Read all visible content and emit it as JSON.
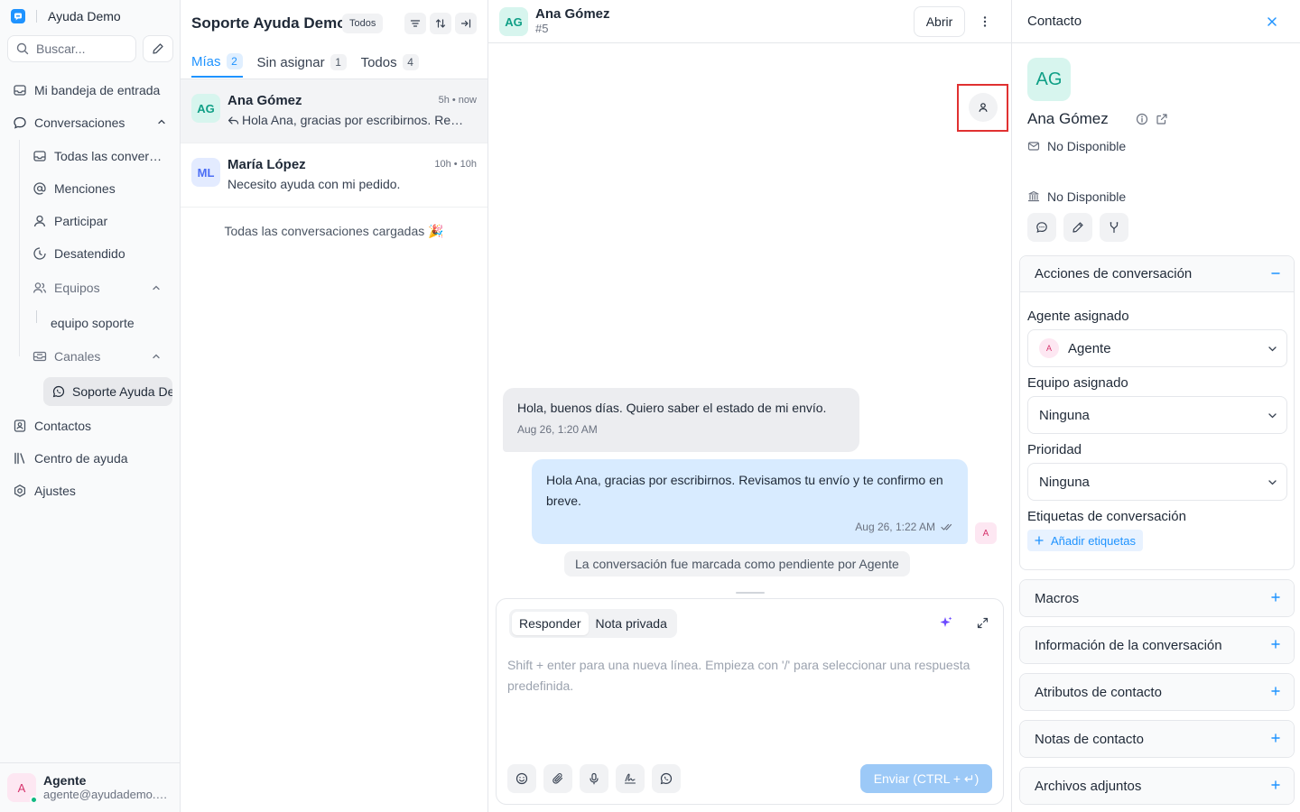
{
  "app": {
    "name": "Ayuda Demo"
  },
  "sidebar": {
    "search_placeholder": "Buscar...",
    "nav": {
      "inbox": "Mi bandeja de entrada",
      "conversations": "Conversaciones",
      "all": "Todas las conversaciones",
      "mentions": "Menciones",
      "participating": "Participar",
      "unattended": "Desatendido",
      "teams": "Equipos",
      "team_support": "equipo soporte",
      "channels": "Canales",
      "channel_support": "Soporte Ayuda Demo",
      "contacts": "Contactos",
      "help_center": "Centro de ayuda",
      "settings": "Ajustes"
    },
    "user": {
      "initial": "A",
      "name": "Agente",
      "email": "agente@ayudademo.com"
    }
  },
  "conv_list": {
    "title": "Soporte Ayuda Demo",
    "badge": "Todos",
    "tabs": [
      {
        "label": "Mías",
        "count": "2"
      },
      {
        "label": "Sin asignar",
        "count": "1"
      },
      {
        "label": "Todos",
        "count": "4"
      }
    ],
    "items": [
      {
        "initials": "AG",
        "name": "Ana Gómez",
        "time": "5h • now",
        "preview": "Hola Ana, gracias por escribirnos. Revisamos tu envío y te confirmo en breve."
      },
      {
        "initials": "ML",
        "name": "María López",
        "time": "10h • 10h",
        "preview": "Necesito ayuda con mi pedido."
      }
    ],
    "all_loaded": "Todas las conversaciones cargadas 🎉"
  },
  "chat": {
    "contact_initials": "AG",
    "contact_name": "Ana Gómez",
    "conv_number": "#5",
    "open_button": "Abrir",
    "messages": [
      {
        "text": "Hola, buenos días. Quiero saber el estado de mi envío.",
        "time": "Aug 26, 1:20 AM"
      },
      {
        "text": "Hola Ana, gracias por escribirnos. Revisamos tu envío y te confirmo en breve.",
        "time": "Aug 26, 1:22 AM",
        "avatar": "A"
      }
    ],
    "activity": "La conversación fue marcada como pendiente por Agente",
    "composer": {
      "reply_tab": "Responder",
      "private_tab": "Nota privada",
      "placeholder": "Shift + enter para una nueva línea. Empieza con '/' para seleccionar una respuesta predefinida.",
      "send_label": "Enviar (CTRL + ↵)"
    }
  },
  "contact": {
    "header": "Contacto",
    "initials": "AG",
    "name": "Ana Gómez",
    "email": "No Disponible",
    "company": "No Disponible",
    "actions_section": {
      "title": "Acciones de conversación",
      "assigned_agent_label": "Agente asignado",
      "assigned_agent_initial": "A",
      "assigned_agent": "Agente",
      "assigned_team_label": "Equipo asignado",
      "assigned_team": "Ninguna",
      "priority_label": "Prioridad",
      "priority": "Ninguna",
      "labels_label": "Etiquetas de conversación",
      "add_labels": "Añadir etiquetas"
    },
    "sections": [
      "Macros",
      "Información de la conversación",
      "Atributos de contacto",
      "Notas de contacto",
      "Archivos adjuntos"
    ]
  },
  "colors": {
    "accent": "#1f93ff",
    "avatar_green": "#0f9f86",
    "avatar_pink": "#d6336c",
    "highlight_frame": "#e03131"
  }
}
